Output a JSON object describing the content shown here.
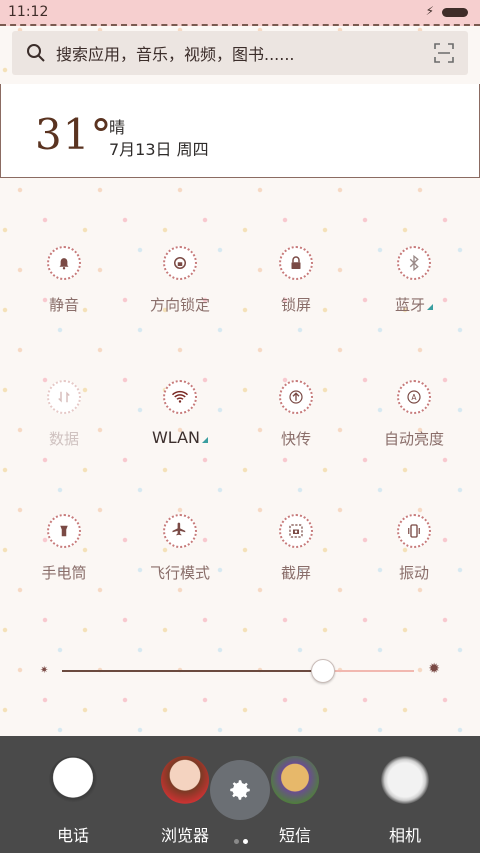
{
  "statusbar": {
    "time": "11:12",
    "icons": [
      "charging-icon",
      "battery-icon"
    ]
  },
  "search": {
    "placeholder": "搜索应用，音乐，视频，图书......",
    "icons": [
      "search-icon",
      "scan-icon"
    ]
  },
  "weather": {
    "temperature": "31°",
    "condition": "晴",
    "date": "7月13日 周四"
  },
  "toggles": [
    {
      "label": "静音",
      "icon": "bell-icon",
      "state": "on"
    },
    {
      "label": "方向锁定",
      "icon": "rotation-lock-icon",
      "state": "on"
    },
    {
      "label": "锁屏",
      "icon": "lock-icon",
      "state": "on"
    },
    {
      "label": "蓝牙",
      "icon": "bluetooth-icon",
      "state": "on",
      "has_more": true
    },
    {
      "label": "数据",
      "icon": "data-icon",
      "state": "disabled"
    },
    {
      "label": "WLAN",
      "icon": "wifi-icon",
      "state": "active",
      "has_more": true
    },
    {
      "label": "快传",
      "icon": "upload-icon",
      "state": "on"
    },
    {
      "label": "自动亮度",
      "icon": "auto-brightness-icon",
      "state": "on"
    },
    {
      "label": "手电筒",
      "icon": "flashlight-icon",
      "state": "on"
    },
    {
      "label": "飞行模式",
      "icon": "airplane-icon",
      "state": "on"
    },
    {
      "label": "截屏",
      "icon": "screenshot-icon",
      "state": "on"
    },
    {
      "label": "振动",
      "icon": "vibrate-icon",
      "state": "on"
    }
  ],
  "brightness": {
    "level": 0.74,
    "icons": [
      "dim-sun-icon",
      "bright-sun-icon"
    ]
  },
  "dock": {
    "apps": [
      {
        "name": "电话",
        "icon": "phone-app-icon"
      },
      {
        "name": "浏览器",
        "icon": "browser-app-icon"
      },
      {
        "name": "短信",
        "icon": "messages-app-icon"
      },
      {
        "name": "相机",
        "icon": "camera-app-icon"
      }
    ],
    "page_indicator": {
      "pages": 2,
      "current": 2
    },
    "settings_icon": "gear-icon"
  },
  "colors": {
    "accent": "#c77b7b",
    "statusbar_bg": "#f6cfcf",
    "dock_bg": "#4a4a4a",
    "wlan_indicator": "#3a9ea0"
  }
}
